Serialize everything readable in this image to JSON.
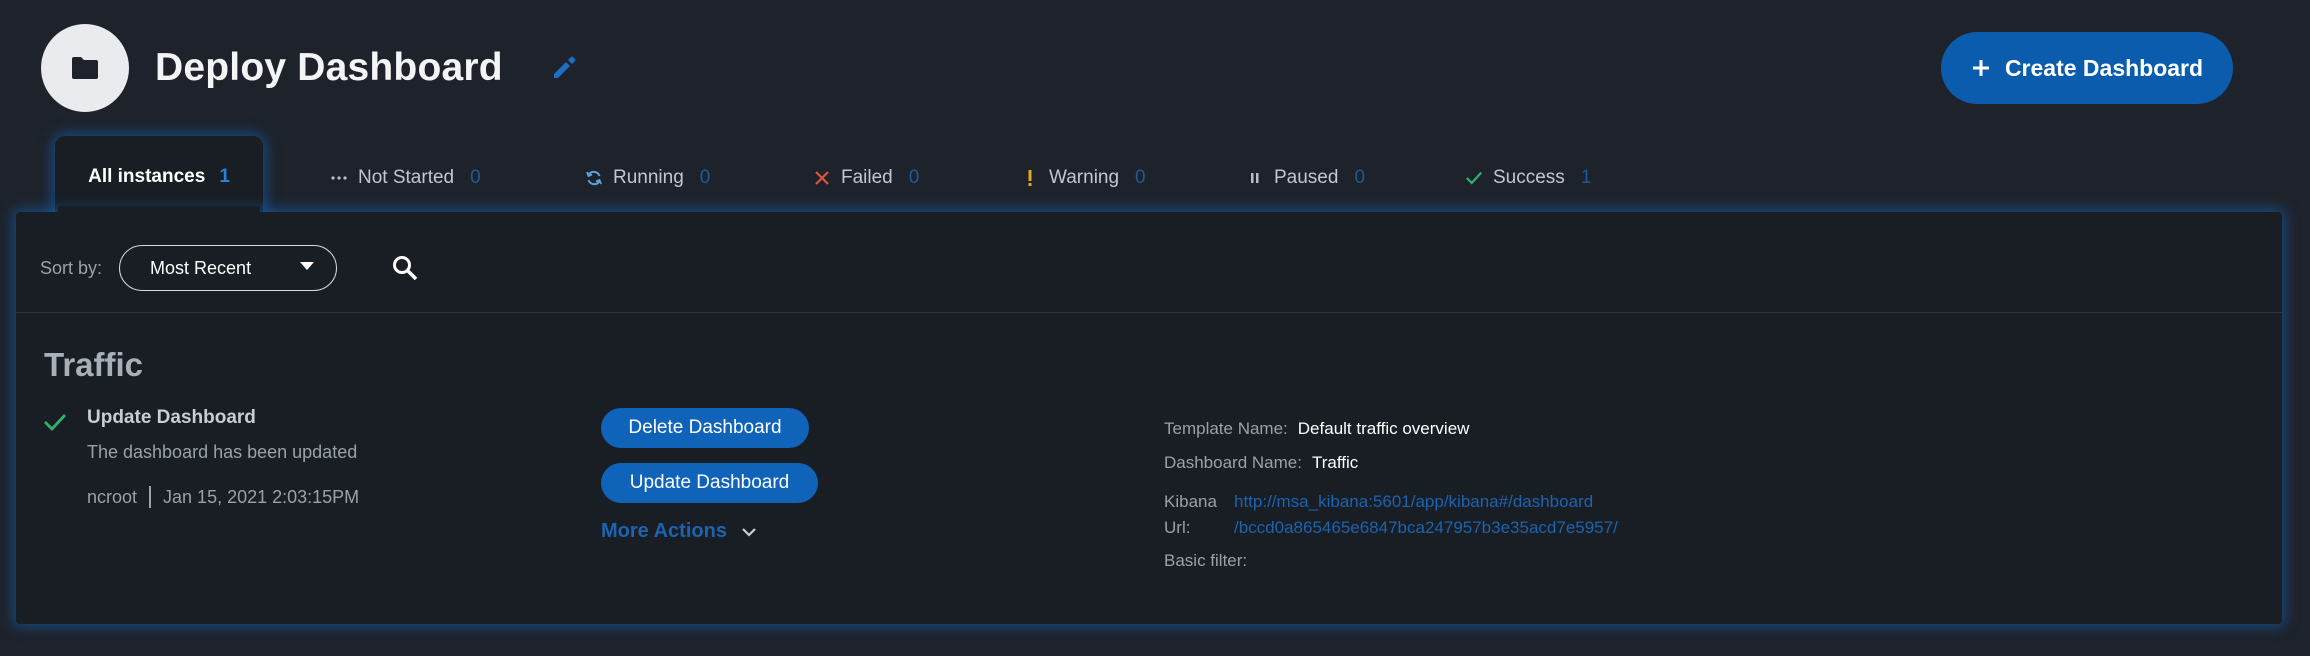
{
  "header": {
    "title": "Deploy Dashboard",
    "create_label": "Create Dashboard"
  },
  "tabs": [
    {
      "label": "All instances",
      "count": "1",
      "icon": "none",
      "active": true
    },
    {
      "label": "Not Started",
      "count": "0",
      "icon": "ellipsis-icon"
    },
    {
      "label": "Running",
      "count": "0",
      "icon": "refresh-icon"
    },
    {
      "label": "Failed",
      "count": "0",
      "icon": "cross-icon"
    },
    {
      "label": "Warning",
      "count": "0",
      "icon": "exclamation-icon"
    },
    {
      "label": "Paused",
      "count": "0",
      "icon": "pause-icon"
    },
    {
      "label": "Success",
      "count": "1",
      "icon": "check-icon"
    }
  ],
  "sort": {
    "label": "Sort by:",
    "value": "Most Recent"
  },
  "instance": {
    "title": "Traffic",
    "action_name": "Update Dashboard",
    "action_desc": "The dashboard has been updated",
    "user": "ncroot",
    "timestamp": "Jan 15, 2021 2:03:15PM",
    "buttons": {
      "delete": "Delete Dashboard",
      "update": "Update Dashboard",
      "more": "More Actions"
    },
    "details": {
      "template_label": "Template Name:",
      "template_value": "Default traffic overview",
      "dashboard_label": "Dashboard Name:",
      "dashboard_value": "Traffic",
      "kibana_label_1": "Kibana",
      "kibana_label_2": "Url:",
      "kibana_url_1": "http://msa_kibana:5601/app/kibana#/dashboard",
      "kibana_url_2": "/bccd0a865465e6847bca247957b3e35acd7e5957/",
      "basic_filter_label": "Basic filter:"
    }
  },
  "colors": {
    "background": "#1e222a",
    "panel": "#191d24",
    "accent": "#0b5cad",
    "link": "#1c63b0",
    "success": "#2fb36a",
    "failed": "#e0533f",
    "warning": "#e3a922"
  }
}
